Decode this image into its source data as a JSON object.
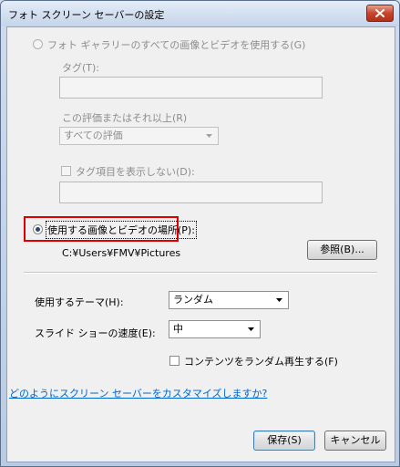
{
  "window": {
    "title": "フォト スクリーン セーバーの設定"
  },
  "gallery_option": {
    "label": "フォト ギャラリーのすべての画像とビデオを使用する(G)",
    "tag_label": "タグ(T):",
    "tag_value": "",
    "rating_label": "この評価またはそれ以上(R)",
    "rating_value": "すべての評価",
    "hide_tags_label": "タグ項目を表示しない(D):",
    "hide_tags_value": ""
  },
  "folder_option": {
    "label": "使用する画像とビデオの場所(P):",
    "path": "C:¥Users¥FMV¥Pictures",
    "browse_label": "参照(B)..."
  },
  "settings": {
    "theme_label": "使用するテーマ(H):",
    "theme_value": "ランダム",
    "speed_label": "スライド ショーの速度(E):",
    "speed_value": "中",
    "shuffle_label": "コンテンツをランダム再生する(F)"
  },
  "help_link": "どのようにスクリーン セーバーをカスタマイズしますか?",
  "buttons": {
    "save": "保存(S)",
    "cancel": "キャンセル"
  },
  "colors": {
    "highlight": "#e00000",
    "link": "#0066cc"
  }
}
